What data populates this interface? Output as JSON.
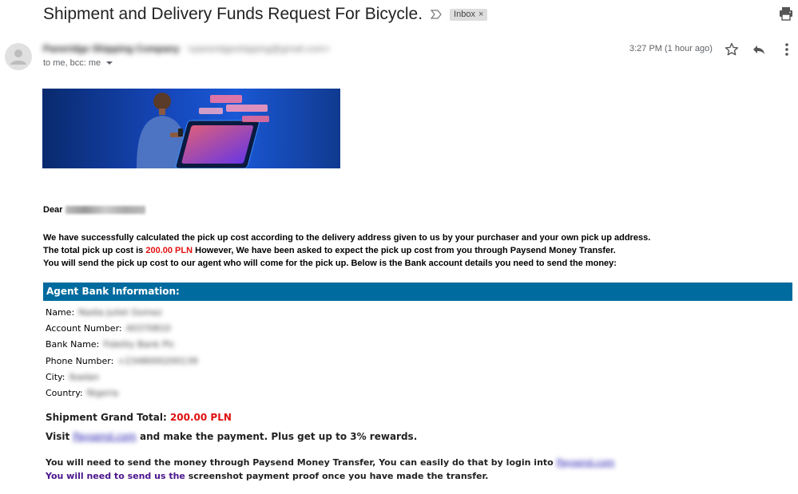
{
  "email": {
    "subject": "Shipment and Delivery Funds Request For Bicycle.",
    "label": "Inbox",
    "label_close": "×",
    "sender_name": "Paneridge Shipping Company",
    "sender_email": "<paneridgeshipping@gmail.com>",
    "recipients": "to me, bcc: me",
    "time": "3:27 PM (1 hour ago)"
  },
  "body": {
    "greeting": "Dear",
    "line1": "We have successfully calculated the pick up cost according to the delivery address given to us by your purchaser and your own pick up address.",
    "line2_prefix": "The total pick up cost is ",
    "line2_amount": "200.00 PLN",
    "line2_suffix": " However, We have been asked to expect the pick up cost from you through Paysend Money Transfer.",
    "line3": "You will send the pick up cost to our agent who will come for the pick up. Below is the Bank account details you need to send the money:",
    "bank_header": "Agent Bank Information:",
    "bank_fields": {
      "name_label": "Name:",
      "name_value": "Nadia Juliet Gomez",
      "account_label": "Account Number:",
      "account_value": "40370810",
      "bankname_label": "Bank Name:",
      "bankname_value": "Fidelity Bank Plc",
      "phone_label": "Phone Number:",
      "phone_value": "+2348000200139",
      "city_label": "City:",
      "city_value": "Ibadan",
      "country_label": "Country:",
      "country_value": "Nigeria"
    },
    "total_label": "Shipment Grand Total: ",
    "total_amount": "200.00 PLN",
    "visit_prefix": "Visit ",
    "visit_link": "Paysend.com",
    "visit_suffix": " and make the payment. Plus get up to 3% rewards.",
    "foot1_text": "You will need to send the money through Paysend Money Transfer, You can easily do that by login into ",
    "foot1_link": "Paysend.com",
    "foot2_a": "You will need to send us the",
    "foot2_b": " screenshot payment proof once you have made the transfer."
  }
}
